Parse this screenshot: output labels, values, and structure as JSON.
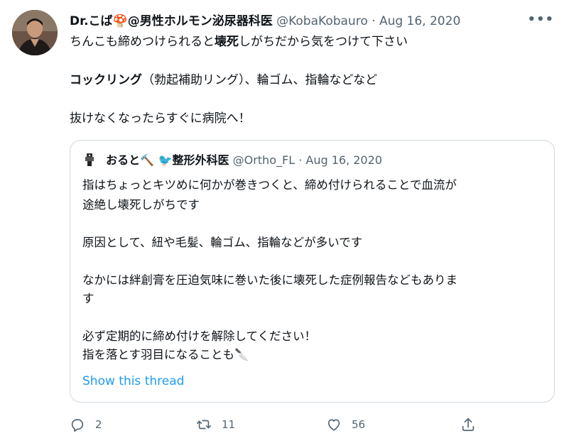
{
  "tweet": {
    "author_name": "Dr.こば🍄@男性ホルモン泌尿器科医",
    "author_handle": "@KobaKobauro",
    "separator": "·",
    "date": "Aug 16, 2020",
    "more": "•••",
    "line1_pre": "ちんこも締めつけられると",
    "line1_bold": "壊死",
    "line1_post": "しがちだから気をつけて下さい",
    "line2_bold": "コックリング",
    "line2_post": "（勃起補助リング）、輪ゴム、指輪などなど",
    "line3": "抜けなくなったらすぐに病院へ！"
  },
  "quote": {
    "author_name": "おると🔨 🐦整形外科医",
    "author_handle": "@Ortho_FL",
    "separator": "·",
    "date": "Aug 16, 2020",
    "lines": [
      "指はちょっとキツめに何かが巻きつくと、締め付けられることで血流が",
      "途絶し壊死しがちです",
      "原因として、紐や毛髪、輪ゴム、指輪などが多いです",
      "なかには絆創膏を圧迫気味に巻いた後に壊死した症例報告などもありま",
      "す",
      "必ず定期的に締め付けを解除してください！",
      "指を落とす羽目になることも🔪"
    ],
    "show_thread": "Show this thread"
  },
  "actions": {
    "reply_count": "2",
    "retweet_count": "11",
    "like_count": "56"
  },
  "colors": {
    "text": "#0f1419",
    "secondary": "#536471",
    "link": "#1d9bf0",
    "border": "#cfd9de"
  }
}
